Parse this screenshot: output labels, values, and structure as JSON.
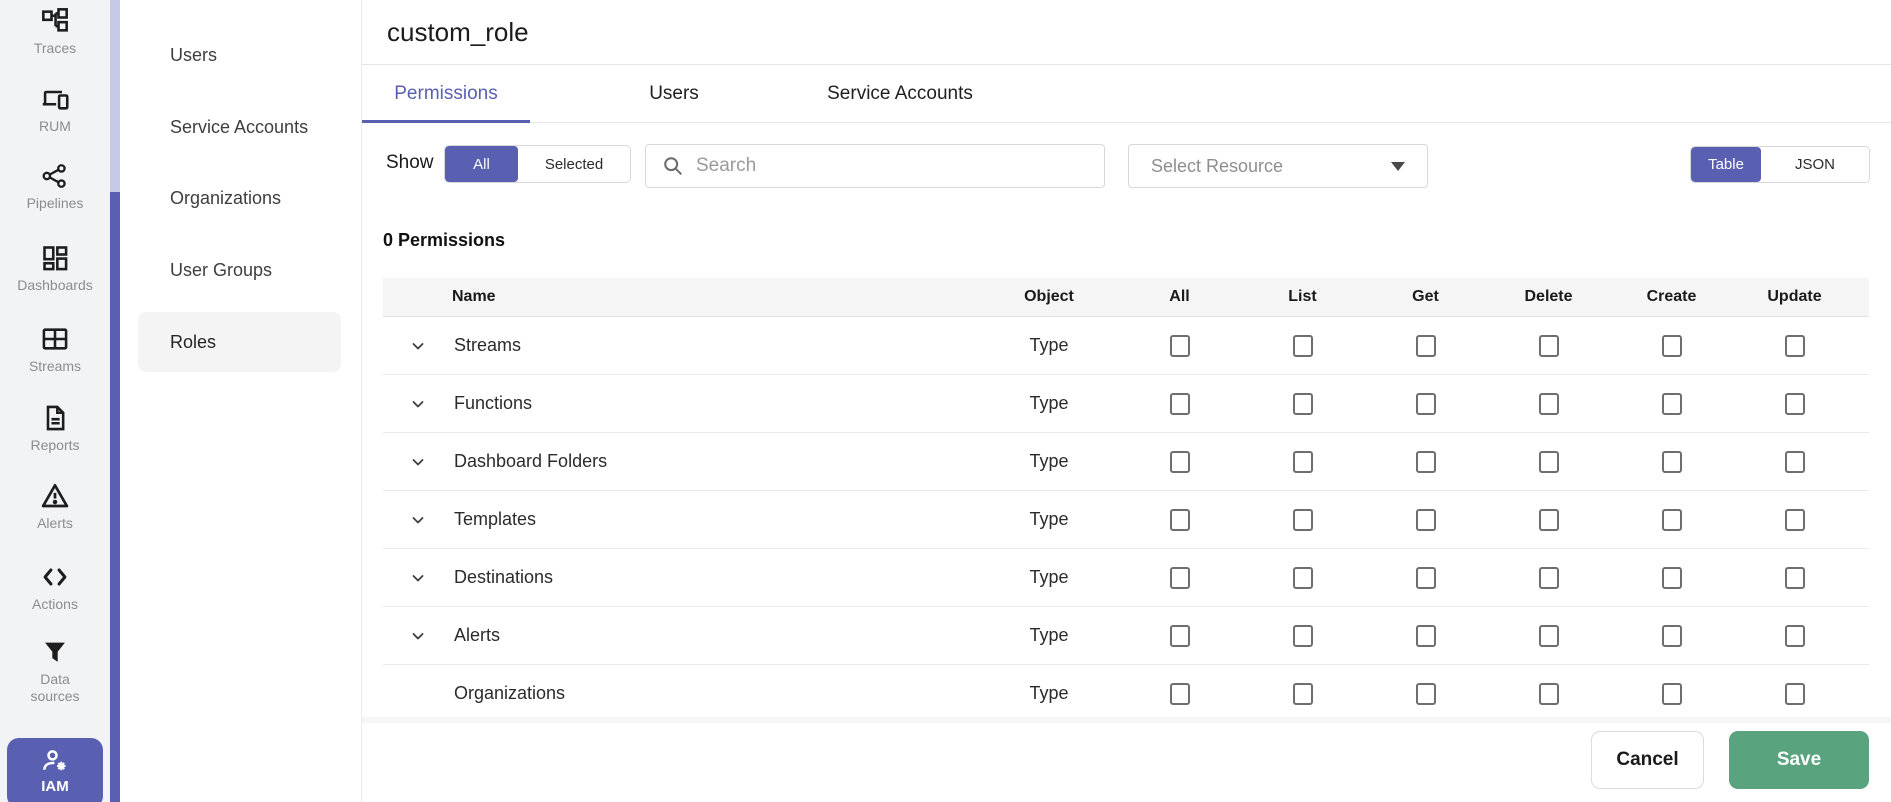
{
  "colors": {
    "primary": "#5960B2",
    "save_green": "#5AA37F",
    "splitter_light": "#C7CAE7",
    "sidebar_bg": "#F2F3F5"
  },
  "sidebar": {
    "items": [
      {
        "label": "Traces"
      },
      {
        "label": "RUM"
      },
      {
        "label": "Pipelines"
      },
      {
        "label": "Dashboards"
      },
      {
        "label": "Streams"
      },
      {
        "label": "Reports"
      },
      {
        "label": "Alerts"
      },
      {
        "label": "Actions"
      },
      {
        "label": "Data sources"
      },
      {
        "label": "IAM",
        "active": true
      }
    ]
  },
  "role_nav": {
    "items": [
      {
        "label": "Users"
      },
      {
        "label": "Service Accounts"
      },
      {
        "label": "Organizations"
      },
      {
        "label": "User Groups"
      },
      {
        "label": "Roles",
        "active": true
      }
    ]
  },
  "header": {
    "title": "custom_role"
  },
  "tabs": [
    {
      "label": "Permissions",
      "active": true
    },
    {
      "label": "Users"
    },
    {
      "label": "Service Accounts"
    }
  ],
  "toolbar": {
    "show_label": "Show",
    "filter_all": "All",
    "filter_selected": "Selected",
    "filter_active": "All",
    "search_placeholder": "Search",
    "resource_placeholder": "Select Resource",
    "view_table": "Table",
    "view_json": "JSON",
    "view_active": "Table"
  },
  "permissions": {
    "count_label": "0 Permissions",
    "columns": [
      "Name",
      "Object",
      "All",
      "List",
      "Get",
      "Delete",
      "Create",
      "Update"
    ],
    "rows": [
      {
        "name": "Streams",
        "object": "Type",
        "expandable": true,
        "checks": {
          "all": false,
          "list": false,
          "get": false,
          "delete": false,
          "create": false,
          "update": false
        }
      },
      {
        "name": "Functions",
        "object": "Type",
        "expandable": true,
        "checks": {
          "all": false,
          "list": false,
          "get": false,
          "delete": false,
          "create": false,
          "update": false
        }
      },
      {
        "name": "Dashboard Folders",
        "object": "Type",
        "expandable": true,
        "checks": {
          "all": false,
          "list": false,
          "get": false,
          "delete": false,
          "create": false,
          "update": false
        }
      },
      {
        "name": "Templates",
        "object": "Type",
        "expandable": true,
        "checks": {
          "all": false,
          "list": false,
          "get": false,
          "delete": false,
          "create": false,
          "update": false
        }
      },
      {
        "name": "Destinations",
        "object": "Type",
        "expandable": true,
        "checks": {
          "all": false,
          "list": false,
          "get": false,
          "delete": false,
          "create": false,
          "update": false
        }
      },
      {
        "name": "Alerts",
        "object": "Type",
        "expandable": true,
        "checks": {
          "all": false,
          "list": false,
          "get": false,
          "delete": false,
          "create": false,
          "update": false
        }
      },
      {
        "name": "Organizations",
        "object": "Type",
        "expandable": false,
        "checks": {
          "all": false,
          "list": false,
          "get": false,
          "delete": false,
          "create": false,
          "update": false
        }
      }
    ]
  },
  "footer": {
    "cancel_label": "Cancel",
    "save_label": "Save"
  }
}
